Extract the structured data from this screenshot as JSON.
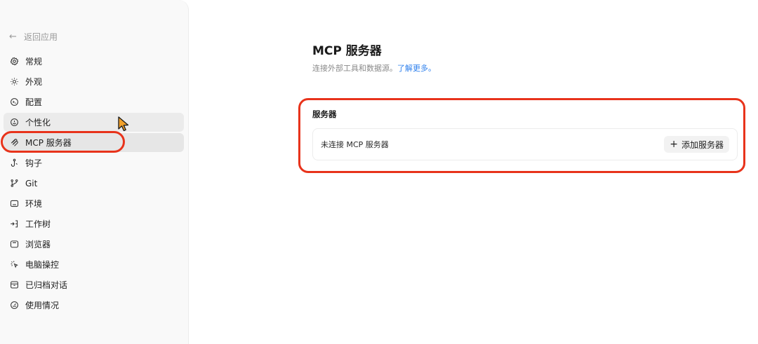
{
  "sidebar": {
    "back_label": "返回应用",
    "items": [
      {
        "label": "常规",
        "icon": "gear-icon"
      },
      {
        "label": "外观",
        "icon": "sun-icon"
      },
      {
        "label": "配置",
        "icon": "config-icon"
      },
      {
        "label": "个性化",
        "icon": "personalize-icon"
      },
      {
        "label": "MCP 服务器",
        "icon": "mcp-icon"
      },
      {
        "label": "钩子",
        "icon": "hook-icon"
      },
      {
        "label": "Git",
        "icon": "git-branch-icon"
      },
      {
        "label": "环境",
        "icon": "terminal-window-icon"
      },
      {
        "label": "工作树",
        "icon": "worktree-icon"
      },
      {
        "label": "浏览器",
        "icon": "browser-icon"
      },
      {
        "label": "电脑操控",
        "icon": "cursor-sparkle-icon"
      },
      {
        "label": "已归档对话",
        "icon": "archive-icon"
      },
      {
        "label": "使用情况",
        "icon": "gauge-icon"
      }
    ]
  },
  "main": {
    "title": "MCP 服务器",
    "subtitle": "连接外部工具和数据源。",
    "learn_more": "了解更多。",
    "section_title": "服务器",
    "empty_state": "未连接 MCP 服务器",
    "add_button": "添加服务器"
  },
  "colors": {
    "highlight": "#e8331b",
    "link": "#2f80ed",
    "sidebar_bg": "#f9f9f9"
  }
}
